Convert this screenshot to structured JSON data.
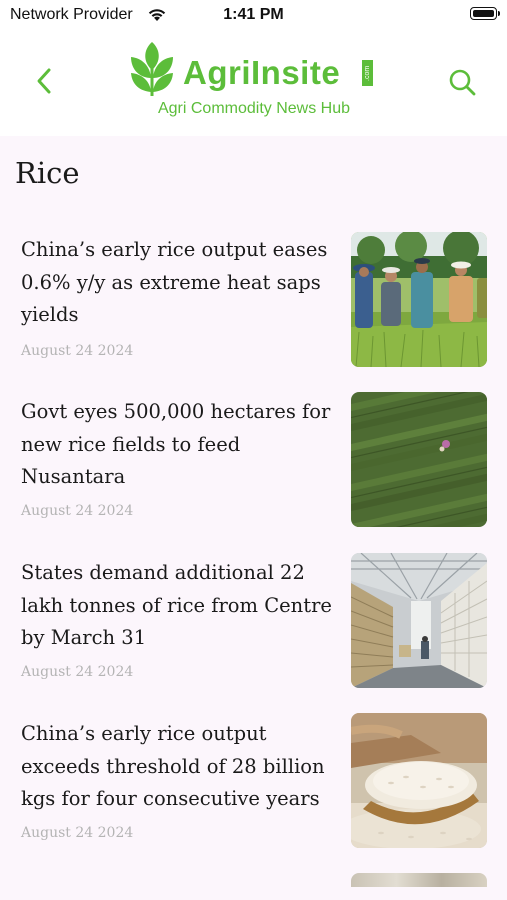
{
  "status_bar": {
    "carrier": "Network Provider",
    "time": "1:41 PM"
  },
  "header": {
    "brand": "AgriInsite",
    "dotcom": ".com",
    "tagline": "Agri Commodity News Hub",
    "back_icon": "chevron-left-icon",
    "search_icon": "search-icon",
    "accent_color": "#5cbd3a"
  },
  "page": {
    "title": "Rice"
  },
  "articles": [
    {
      "title": "China’s early rice output eases 0.6% y/y as extreme heat saps yields",
      "date": "August 24 2024",
      "image": "farmers-in-rice-field"
    },
    {
      "title": "Govt eyes 500,000 hectares for new rice fields to feed Nusantara",
      "date": "August 24 2024",
      "image": "aerial-rice-field"
    },
    {
      "title": "States demand additional 22 lakh tonnes of rice from Centre by March 31",
      "date": "August 24 2024",
      "image": "rice-sack-warehouse"
    },
    {
      "title": "China’s early rice output exceeds threshold of 28 billion kgs for four consecutive years",
      "date": "August 24 2024",
      "image": "rice-in-wooden-spoon"
    }
  ]
}
